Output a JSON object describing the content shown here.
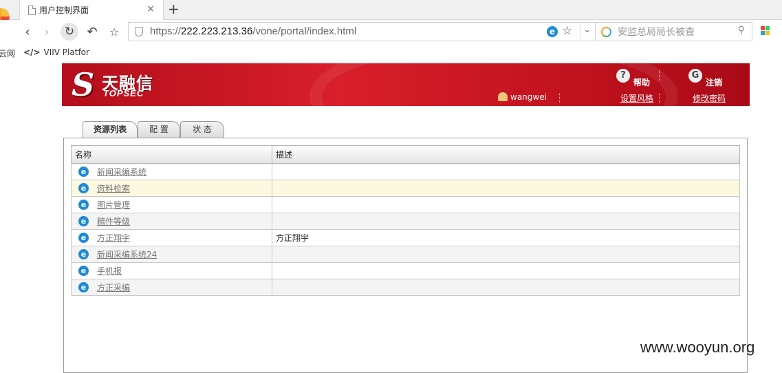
{
  "browser": {
    "tab": {
      "title": "用户控制界面",
      "close": "×"
    },
    "new_tab": "+",
    "nav": {
      "back": "‹",
      "forward": "›",
      "reload": "↻",
      "undo": "↶",
      "star": "☆"
    },
    "address": {
      "url_prefix": "https://",
      "url_host": "222.223.213.36",
      "url_path": "/vone/portal/index.html",
      "fav": "☆",
      "dropdown": "⌄",
      "ie": "e"
    },
    "search": {
      "placeholder": "安监总局局长被查",
      "button": "⚲"
    },
    "bookmarks": [
      {
        "label": "云网"
      },
      {
        "code": "</>",
        "label": "VIIV Platfor"
      }
    ]
  },
  "header": {
    "logo": {
      "mark": "S",
      "cn": "天融信",
      "en": "TOPSEC"
    },
    "help": {
      "icon": "?",
      "label": "帮助"
    },
    "logout": {
      "icon": "G",
      "label": "注销"
    },
    "user": "wangwei",
    "style_link": "设置风格",
    "password_link": "修改密码"
  },
  "tabs": [
    {
      "label": "资源列表",
      "active": true
    },
    {
      "label": "配 置",
      "active": false
    },
    {
      "label": "状 态",
      "active": false
    }
  ],
  "table": {
    "headers": [
      "名称",
      "描述"
    ],
    "rows": [
      {
        "name": "新闻采编系统",
        "desc": ""
      },
      {
        "name": "资料检索",
        "desc": ""
      },
      {
        "name": "图片管理",
        "desc": ""
      },
      {
        "name": "稿件等级",
        "desc": ""
      },
      {
        "name": "方正翔宇",
        "desc": "方正翔宇"
      },
      {
        "name": "新闻采编系统24",
        "desc": ""
      },
      {
        "name": "手机报",
        "desc": ""
      },
      {
        "name": "方正采编",
        "desc": ""
      }
    ]
  },
  "watermark": "www.wooyun.org",
  "colors": {
    "header_red": "#c8161f",
    "highlight_row": "#fdf8e0",
    "link_gray": "#777777"
  }
}
